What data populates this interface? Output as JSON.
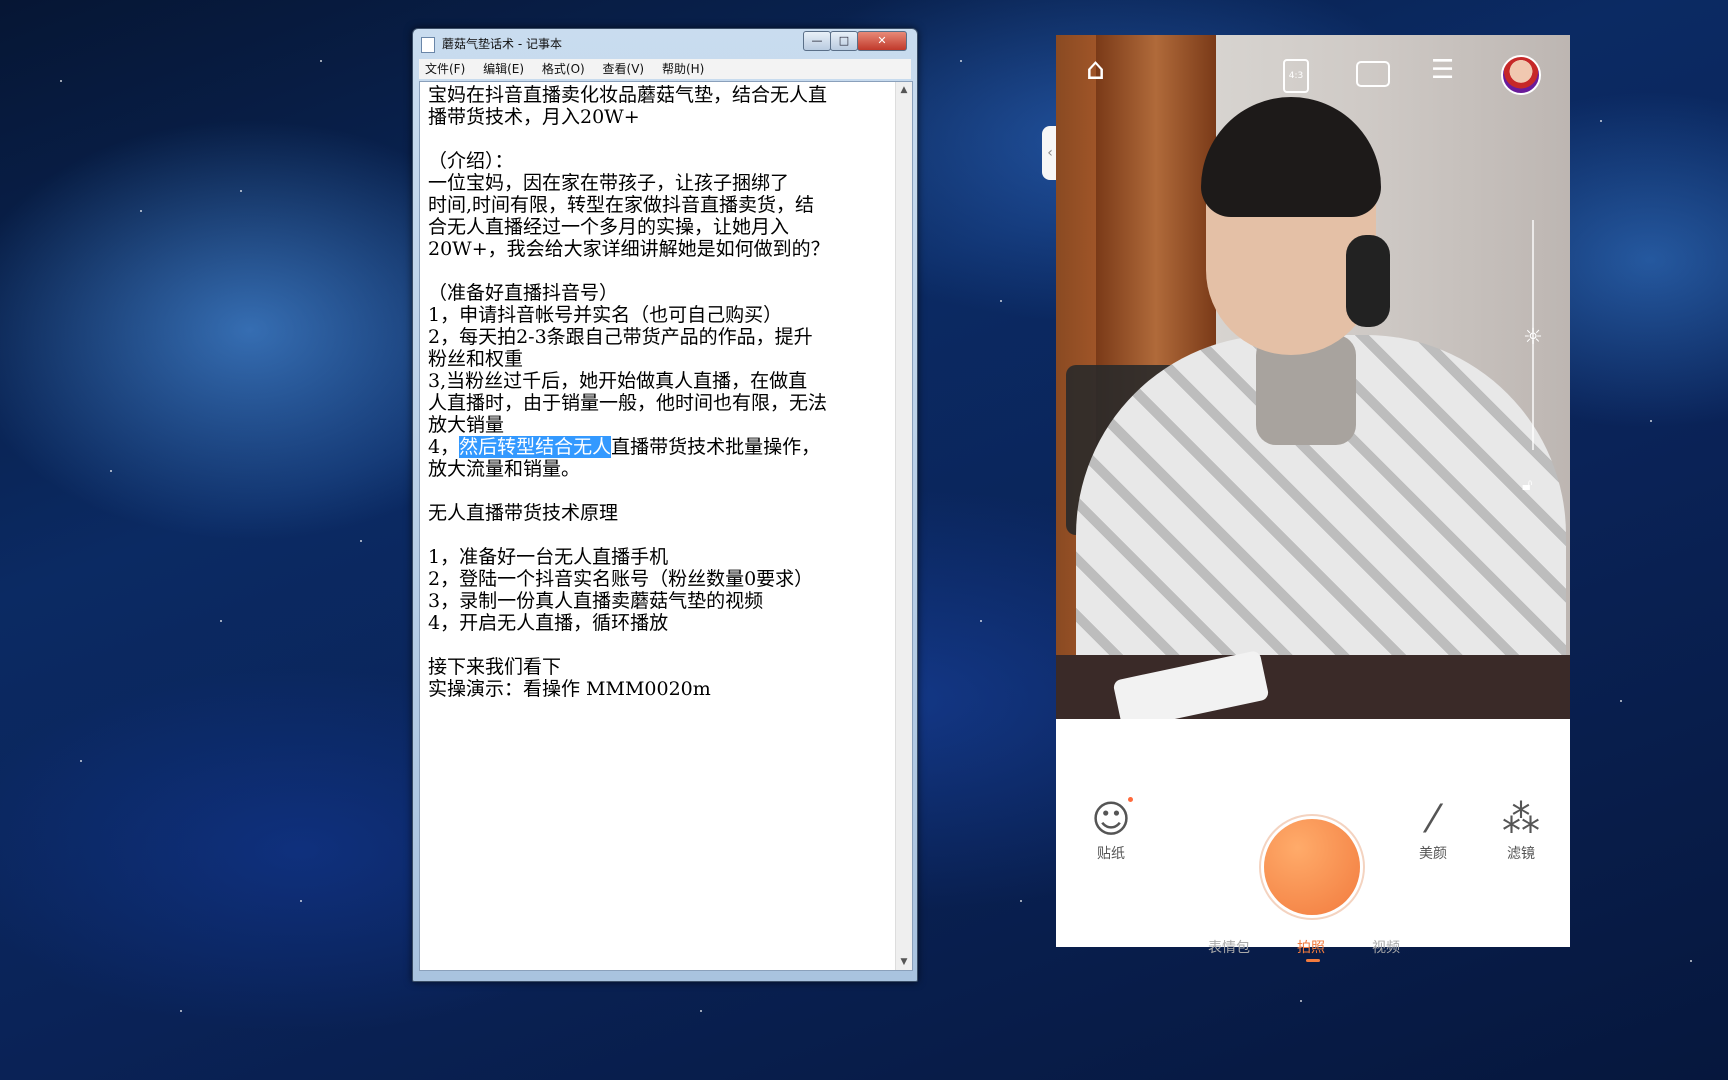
{
  "notepad": {
    "title": "蘑菇气垫话术 - 记事本",
    "window_buttons": {
      "minimize": "—",
      "maximize": "□",
      "close": "✕"
    },
    "menu": [
      "文件(F)",
      "编辑(E)",
      "格式(O)",
      "查看(V)",
      "帮助(H)"
    ],
    "lines": [
      "宝妈在抖音直播卖化妆品蘑菇气垫，结合无人直",
      "播带货技术，月入20W+",
      "",
      "（介绍）：",
      "  一位宝妈，因在家在带孩子，让孩子捆绑了",
      "时间,时间有限，转型在家做抖音直播卖货，结",
      "合无人直播经过一个多月的实操，让她月入",
      "20W+，我会给大家详细讲解她是如何做到的？",
      "",
      "   （准备好直播抖音号）",
      "1，申请抖音帐号并实名（也可自己购买）",
      "2，每天拍2-3条跟自己带货产品的作品，提升",
      "粉丝和权重",
      "3,当粉丝过千后，她开始做真人直播，在做直",
      "人直播时，由于销量一般，他时间也有限，无法",
      "放大销量",
      "",
      "放大流量和销量。",
      "",
      "    无人直播带货技术原理",
      "",
      "1，准备好一台无人直播手机",
      "2，登陆一个抖音实名账号（粉丝数量0要求）",
      "3，录制一份真人直播卖蘑菇气垫的视频",
      "4，开启无人直播，循环播放",
      "",
      "接下来我们看下",
      "实操演示：看操作 MMM0020m"
    ],
    "line_4_prefix": "4，",
    "line_4_selected": "然后转型结合无人",
    "line_4_rest": "直播带货技术批量操作，"
  },
  "camera": {
    "collapse_arrow": "‹",
    "top_icons": [
      "home-icon",
      "aspect-ratio-icon",
      "switch-camera-icon",
      "settings-sliders-icon",
      "avatar"
    ],
    "ratio_label": "4:3",
    "controls": {
      "sticker": "贴纸",
      "beauty": "美颜",
      "filter": "滤镜"
    },
    "modes": [
      "表情包",
      "拍照",
      "视频"
    ],
    "active_mode": "拍照",
    "accent_color": "#f27b3e"
  }
}
